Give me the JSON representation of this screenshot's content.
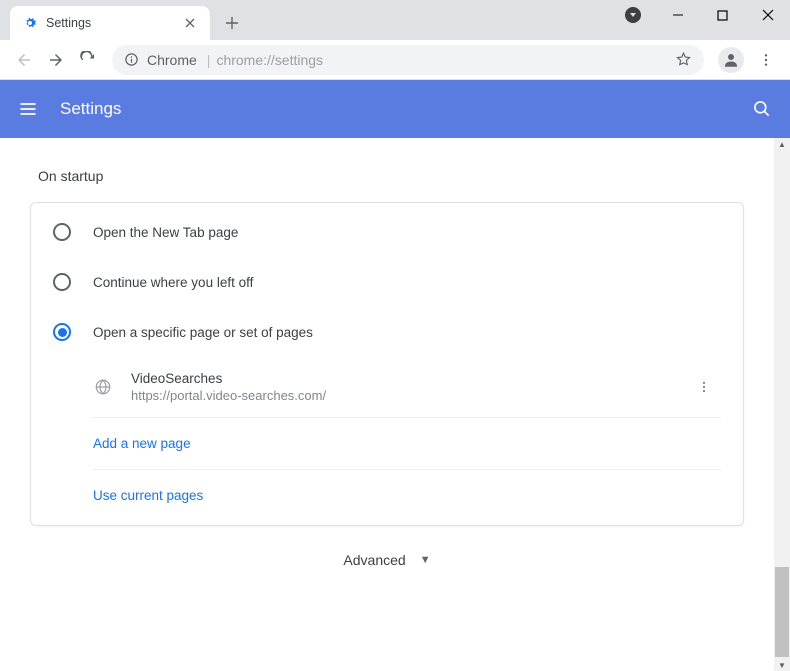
{
  "tab": {
    "title": "Settings"
  },
  "omnibox": {
    "label": "Chrome",
    "url": "chrome://settings"
  },
  "header": {
    "title": "Settings"
  },
  "section": {
    "title": "On startup"
  },
  "options": {
    "newtab": "Open the New Tab page",
    "continue": "Continue where you left off",
    "specific": "Open a specific page or set of pages"
  },
  "page": {
    "name": "VideoSearches",
    "url": "https://portal.video-searches.com/"
  },
  "links": {
    "add": "Add a new page",
    "current": "Use current pages"
  },
  "advanced": "Advanced"
}
